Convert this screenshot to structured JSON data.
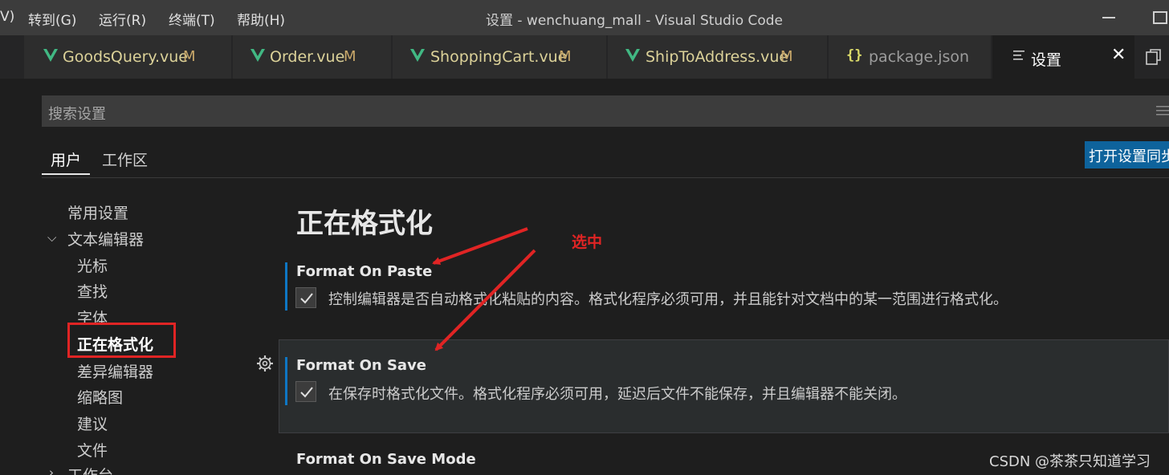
{
  "menubar": {
    "items": [
      "V)",
      "转到(G)",
      "运行(R)",
      "终端(T)",
      "帮助(H)"
    ],
    "window_title": "设置 - wenchuang_mall - Visual Studio Code"
  },
  "tabs": [
    {
      "label": "GoodsQuery.vue",
      "badge": "M",
      "icon": "vue-icon"
    },
    {
      "label": "Order.vue",
      "badge": "M",
      "icon": "vue-icon"
    },
    {
      "label": "ShoppingCart.vue",
      "badge": "M",
      "icon": "vue-icon"
    },
    {
      "label": "ShipToAddress.vue",
      "badge": "M",
      "icon": "vue-icon"
    },
    {
      "label": "package.json",
      "badge": "",
      "icon": "json-icon",
      "icon_glyph": "{}"
    },
    {
      "label": "设置",
      "badge": "",
      "icon": "settings-tab-icon",
      "active": true
    }
  ],
  "search": {
    "placeholder": "搜索设置"
  },
  "scope": {
    "user": "用户",
    "workspace": "工作区",
    "sync_button": "打开设置同步"
  },
  "tree": {
    "common": "常用设置",
    "text_editor": "文本编辑器",
    "children": [
      "光标",
      "查找",
      "字体",
      "正在格式化",
      "差异编辑器",
      "缩略图",
      "建议",
      "文件"
    ],
    "selected": "正在格式化",
    "workbench": "工作台"
  },
  "content": {
    "section_title": "正在格式化",
    "settings": [
      {
        "title": "Format On Paste",
        "checked": true,
        "description": "控制编辑器是否自动格式化粘贴的内容。格式化程序必须可用，并且能针对文档中的某一范围进行格式化。"
      },
      {
        "title": "Format On Save",
        "checked": true,
        "description": "在保存时格式化文件。格式化程序必须可用，延迟后文件不能保存，并且编辑器不能关闭。"
      },
      {
        "title": "Format On Save Mode"
      }
    ]
  },
  "annotation": {
    "text": "选中",
    "color": "#e02424"
  },
  "watermark": "CSDN @茶茶只知道学习",
  "colors": {
    "accent": "#0e639c",
    "vue_green": "#41b883",
    "modified": "#c9a86a"
  }
}
